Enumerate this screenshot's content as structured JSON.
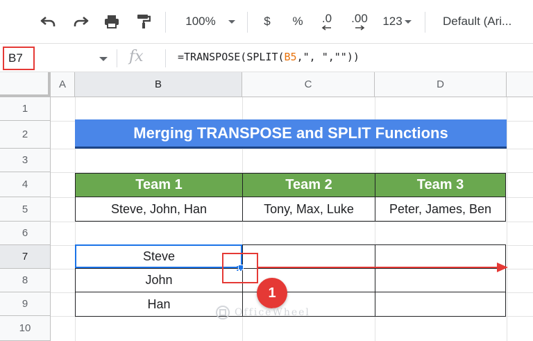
{
  "toolbar": {
    "zoom": "100%",
    "currency": "$",
    "percent": "%",
    "decrease_decimal": ".0",
    "increase_decimal": ".00",
    "more_formats": "123",
    "font": "Default (Ari..."
  },
  "formula_bar": {
    "name_box": "B7",
    "fx": "fx",
    "formula_prefix": "=TRANSPOSE(SPLIT(",
    "formula_ref": "B5",
    "formula_suffix": ",\", \",\"\"))"
  },
  "grid": {
    "columns": [
      "A",
      "B",
      "C",
      "D"
    ],
    "rows": [
      "1",
      "2",
      "3",
      "4",
      "5",
      "6",
      "7",
      "8",
      "9",
      "10"
    ],
    "title": "Merging TRANSPOSE and SPLIT Functions",
    "headers": [
      "Team 1",
      "Team 2",
      "Team 3"
    ],
    "row5": [
      "Steve, John, Han",
      "Tony, Max, Luke",
      "Peter, James, Ben"
    ],
    "results": [
      "Steve",
      "John",
      "Han"
    ]
  },
  "annotation": {
    "badge": "1",
    "fill_handle_glyph": "::"
  },
  "watermark": "OfficeWheel",
  "colors": {
    "title_bg": "#4a86e8",
    "header_bg": "#6aa84f",
    "annotation_red": "#e53935",
    "selection_blue": "#1a73e8"
  },
  "icons": [
    "undo-icon",
    "redo-icon",
    "print-icon",
    "paint-format-icon",
    "dropdown-caret-icon",
    "function-icon",
    "watermark-logo-icon"
  ]
}
